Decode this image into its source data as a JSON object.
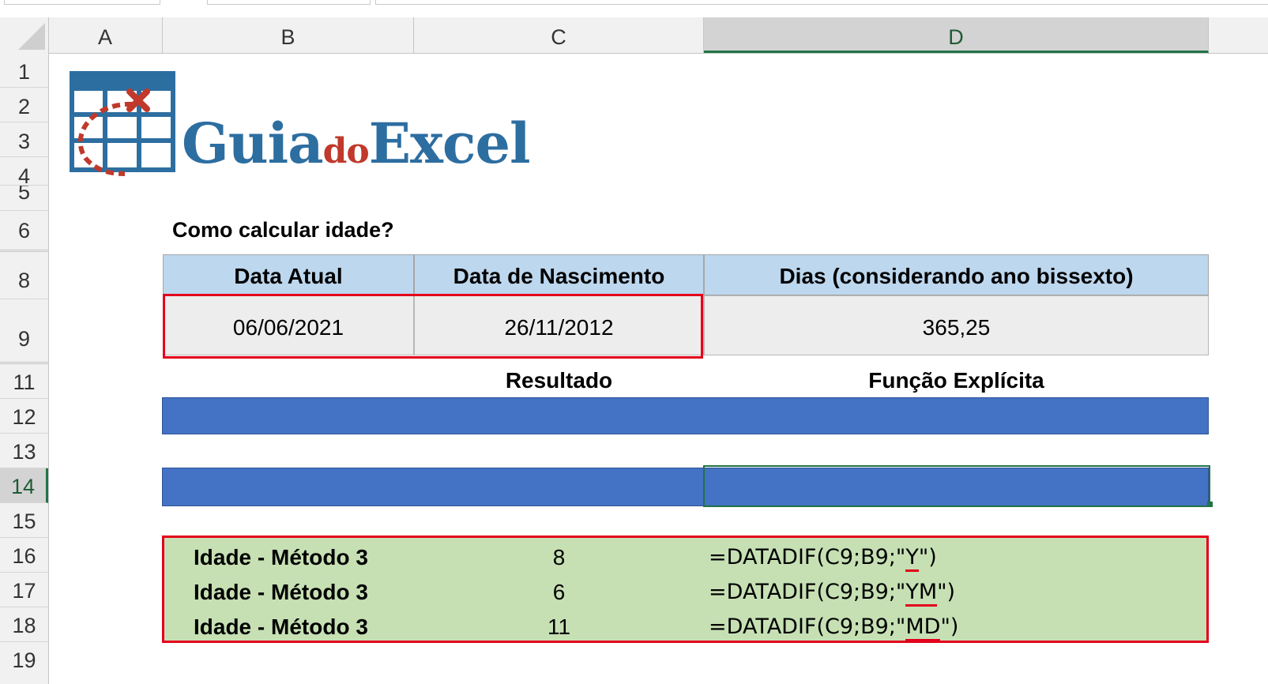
{
  "column_headers": [
    "A",
    "B",
    "C",
    "D"
  ],
  "selected_column": "D",
  "row_headers": [
    "1",
    "2",
    "3",
    "4",
    "5",
    "6",
    "8",
    "9",
    "11",
    "12",
    "13",
    "14",
    "15",
    "16",
    "17",
    "18",
    "19"
  ],
  "selected_row": "14",
  "logo": {
    "text_main": "Guia",
    "text_mid": "do",
    "text_end": "Excel",
    "colors": {
      "blue": "#2d6ea1",
      "red": "#c0392b"
    }
  },
  "sheet": {
    "title": "Como calcular idade?",
    "table": {
      "headers": [
        "Data Atual",
        "Data de Nascimento",
        "Dias (considerando ano bissexto)"
      ],
      "values": [
        "06/06/2021",
        "26/11/2012",
        "365,25"
      ]
    },
    "result_header": "Resultado",
    "function_header": "Função Explícita",
    "results": [
      {
        "label": "Idade - Método 3",
        "value": "8",
        "fn_prefix": "=DATADIF(C9;B9;\"",
        "fn_arg": "Y",
        "fn_suffix": "\")"
      },
      {
        "label": "Idade - Método 3",
        "value": "6",
        "fn_prefix": "=DATADIF(C9;B9;\"",
        "fn_arg": "YM",
        "fn_suffix": "\")"
      },
      {
        "label": "Idade - Método 3",
        "value": "11",
        "fn_prefix": "=DATADIF(C9;B9;\"",
        "fn_arg": "MD",
        "fn_suffix": "\")"
      }
    ]
  },
  "colors": {
    "header_fill": "#bdd7ee",
    "blue_bar": "#4472c4",
    "green_fill": "#c6e0b4",
    "highlight_border": "#e3001b",
    "excel_green": "#217346"
  }
}
